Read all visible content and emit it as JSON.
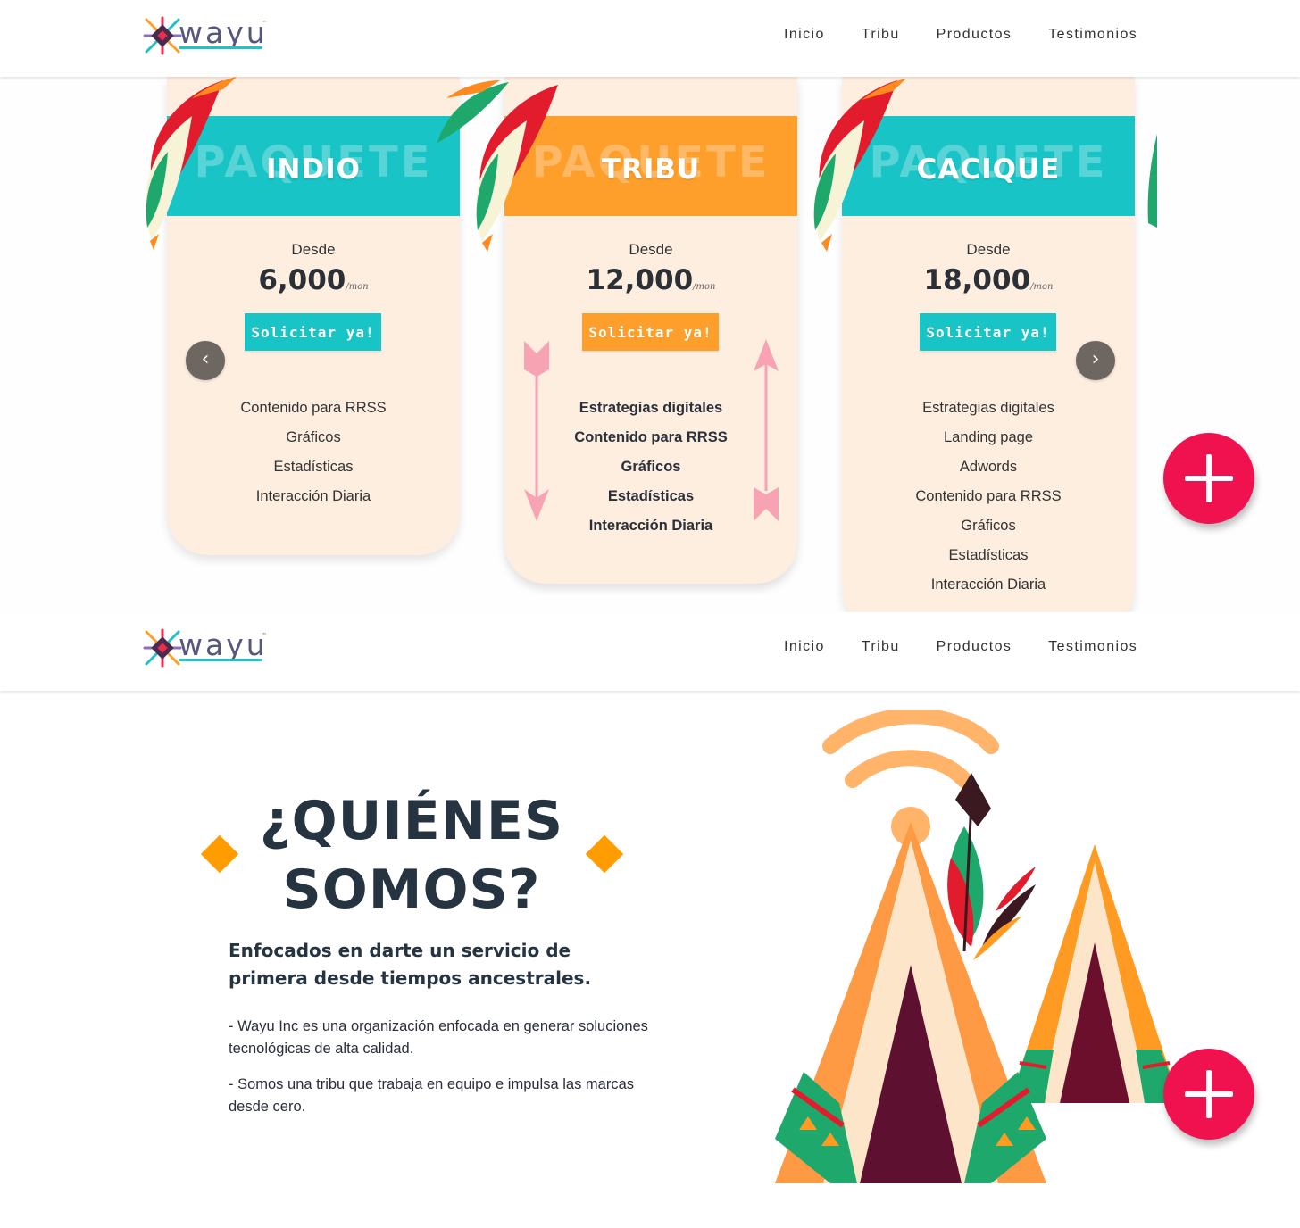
{
  "brand": {
    "logo_text": "wayu",
    "tm": "™"
  },
  "nav": {
    "items": [
      "Inicio",
      "Tribu",
      "Productos",
      "Testimonios"
    ]
  },
  "pricing": {
    "ghost_word": "PAQUETE",
    "desde_label": "Desde",
    "price_unit": "/mon",
    "button_label": "Solicitar ya!",
    "cards": [
      {
        "name": "INDIO",
        "price": "6,000",
        "color": "#18c4c6",
        "features": [
          "Contenido para RRSS",
          "Gráficos",
          "Estadísticas",
          "Interacción Diaria"
        ]
      },
      {
        "name": "TRIBU",
        "price": "12,000",
        "color": "#ff9f2b",
        "features": [
          "Estrategias digitales",
          "Contenido para RRSS",
          "Gráficos",
          "Estadísticas",
          "Interacción Diaria"
        ]
      },
      {
        "name": "CACIQUE",
        "price": "18,000",
        "color": "#18c4c6",
        "features": [
          "Estrategias digitales",
          "Landing page",
          "Adwords",
          "Contenido para RRSS",
          "Gráficos",
          "Estadísticas",
          "Interacción Diaria"
        ]
      }
    ],
    "prev_icon": "chevron-left-icon",
    "next_icon": "chevron-right-icon"
  },
  "about": {
    "title_line1": "¿QUIÉNES",
    "title_line2": "SOMOS?",
    "subtitle": "Enfocados en darte un servicio de primera desde tiempos ancestrales.",
    "paragraph1": "- Wayu Inc es una organización enfocada en generar soluciones tecnológicas de alta calidad.",
    "paragraph2": "- Somos una tribu que trabaja en equipo e impulsa las marcas desde cero."
  },
  "fab_icon": "plus-icon",
  "colors": {
    "teal": "#18c4c6",
    "orange": "#ff9f2b",
    "cream": "#fdeee0",
    "fab": "#f0124f",
    "dark": "#263442",
    "maroon": "#5e1030"
  }
}
